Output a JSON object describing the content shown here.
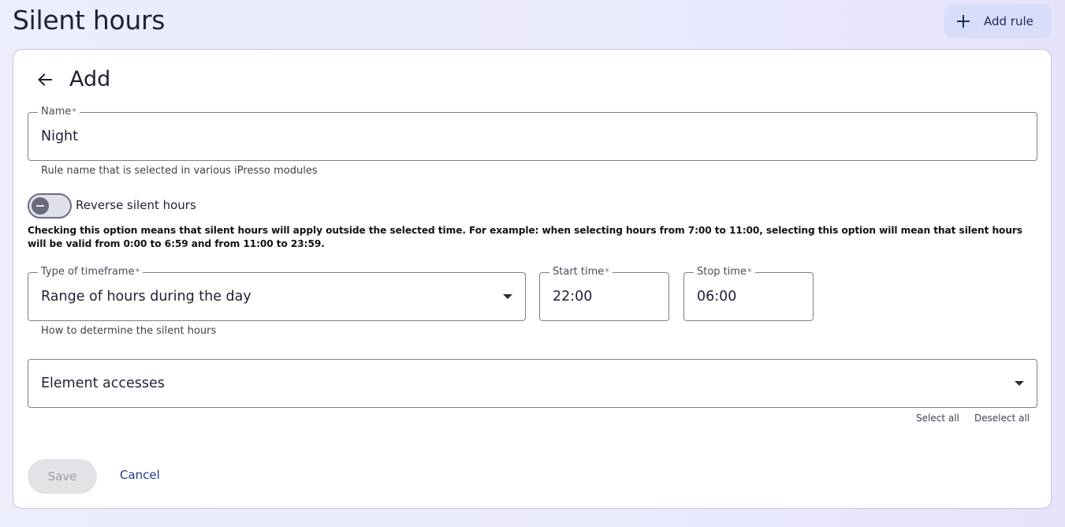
{
  "header": {
    "title": "Silent hours",
    "add_rule_label": "Add rule"
  },
  "form": {
    "title": "Add",
    "name": {
      "label": "Name",
      "required_mark": "*",
      "value": "Night",
      "helper": "Rule name that is selected in various iPresso modules"
    },
    "reverse": {
      "label": "Reverse silent hours",
      "checked": false,
      "explanation": "Checking this option means that silent hours will apply outside the selected time. For example: when selecting hours from 7:00 to 11:00, selecting this option will mean that silent hours will be valid from 0:00 to 6:59 and from 11:00 to 23:59."
    },
    "timeframe": {
      "label": "Type of timeframe",
      "required_mark": "*",
      "value": "Range of hours during the day",
      "helper": "How to determine the silent hours"
    },
    "start_time": {
      "label": "Start time",
      "required_mark": "*",
      "value": "22:00"
    },
    "stop_time": {
      "label": "Stop time",
      "required_mark": "*",
      "value": "06:00"
    },
    "element_accesses": {
      "placeholder": "Element accesses",
      "select_all": "Select all",
      "deselect_all": "Deselect all"
    },
    "save_label": "Save",
    "cancel_label": "Cancel"
  },
  "colors": {
    "accent": "#1f3a8a",
    "add_button_bg": "#d8ddfa",
    "disabled_bg": "#e2e3e7"
  },
  "icons": {
    "add": "plus-icon",
    "back": "arrow-left-icon",
    "dropdown": "caret-down-icon",
    "toggle": "minus-icon"
  }
}
